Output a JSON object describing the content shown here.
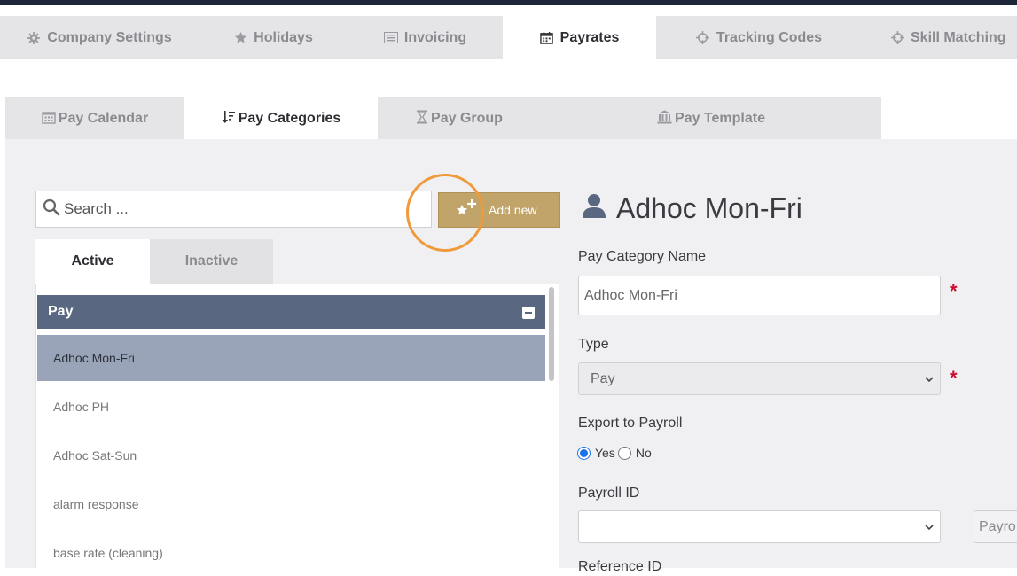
{
  "top_tabs": [
    {
      "label": "Company Settings",
      "icon": "gear-icon",
      "active": false
    },
    {
      "label": "Holidays",
      "icon": "star-icon",
      "active": false
    },
    {
      "label": "Invoicing",
      "icon": "invoice-icon",
      "active": false
    },
    {
      "label": "Payrates",
      "icon": "calendar-icon",
      "active": true
    },
    {
      "label": "Tracking Codes",
      "icon": "crosshair-icon",
      "active": false
    },
    {
      "label": "Skill Matching",
      "icon": "crosshair-icon",
      "active": false
    }
  ],
  "sub_tabs": [
    {
      "label": "Pay Calendar",
      "icon": "calendar-icon",
      "active": false
    },
    {
      "label": "Pay Categories",
      "icon": "sort-icon",
      "active": true
    },
    {
      "label": "Pay Group",
      "icon": "hourglass-icon",
      "active": false
    },
    {
      "label": "Pay Template",
      "icon": "bank-icon",
      "active": false
    }
  ],
  "search": {
    "placeholder": "Search ..."
  },
  "add_button": {
    "label": "Add new"
  },
  "status_tabs": [
    {
      "label": "Active",
      "active": true
    },
    {
      "label": "Inactive",
      "active": false
    }
  ],
  "list": {
    "group_label": "Pay",
    "items": [
      {
        "label": "Adhoc Mon-Fri",
        "selected": true
      },
      {
        "label": "Adhoc PH",
        "selected": false
      },
      {
        "label": "Adhoc Sat-Sun",
        "selected": false
      },
      {
        "label": "alarm response",
        "selected": false
      },
      {
        "label": "base rate (cleaning)",
        "selected": false
      }
    ]
  },
  "detail": {
    "title": "Adhoc Mon-Fri",
    "name_label": "Pay Category Name",
    "name_value": "Adhoc Mon-Fri",
    "type_label": "Type",
    "type_value": "Pay",
    "export_label": "Export to Payroll",
    "yes_label": "Yes",
    "no_label": "No",
    "payroll_id_label": "Payroll ID",
    "payroll_id_value": "",
    "payroll_side_text": "Payro",
    "reference_label": "Reference ID",
    "required_mark": "*"
  },
  "colors": {
    "accent_gold": "#c1a46a",
    "group_header": "#5a6781",
    "selected_row": "#9aa4b8",
    "highlight_ring": "#ef9a3b",
    "required": "#c8102e"
  }
}
